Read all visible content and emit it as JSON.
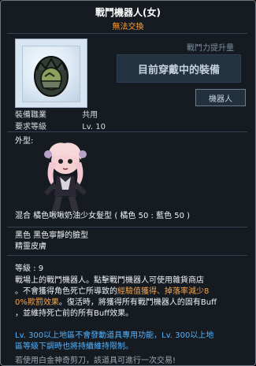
{
  "item": {
    "title": "戰鬥機器人(女)",
    "trade_status": "無法交換",
    "power_label": "戰鬥力提升量",
    "power_text": "目前穿戴中的裝備",
    "category_tag": "機器人",
    "job_label": "裝備職業",
    "job_value": "共用",
    "level_label": "要求等級",
    "level_value": "Lv. 10",
    "appearance_label": "外型:",
    "hair_line": "混合 橘色啾啾奶油少女髮型 ( 橘色 50 : 藍色 50 )",
    "eye_line": "黑色 黑色寧靜的臉型",
    "skin_line": "精靈皮膚",
    "upgrade_line": "等級 : 9",
    "desc_line_1": "戰場上的戰鬥機器人。點擊戰鬥機器人可使用雜貨商店",
    "desc_line_2a": "。不會獲得角色死亡所導致的",
    "desc_line_2b": "經驗值獲得、掉落率減少8",
    "desc_line_3a": "0%",
    "desc_line_3b": "欺罰效果",
    "desc_line_3c": "。復活時，將獲得所有戰鬥機器人的固有Buff",
    "desc_line_4": "，並維持死亡前的所有Buff效果。",
    "blue_line_1": "Lv. 300以上地區不會發動道具專用功能，Lv. 300以上地",
    "blue_line_2": "區等級下調時也將持續維持限制。",
    "footer_line": "若使用白金神奇剪刀，該道具可進行一次交易!"
  },
  "colors": {
    "title": "#ffffff",
    "trade_status": "#ff9f3b",
    "highlight_orange": "#f8a34a",
    "highlight_blue": "#52b3ff"
  }
}
